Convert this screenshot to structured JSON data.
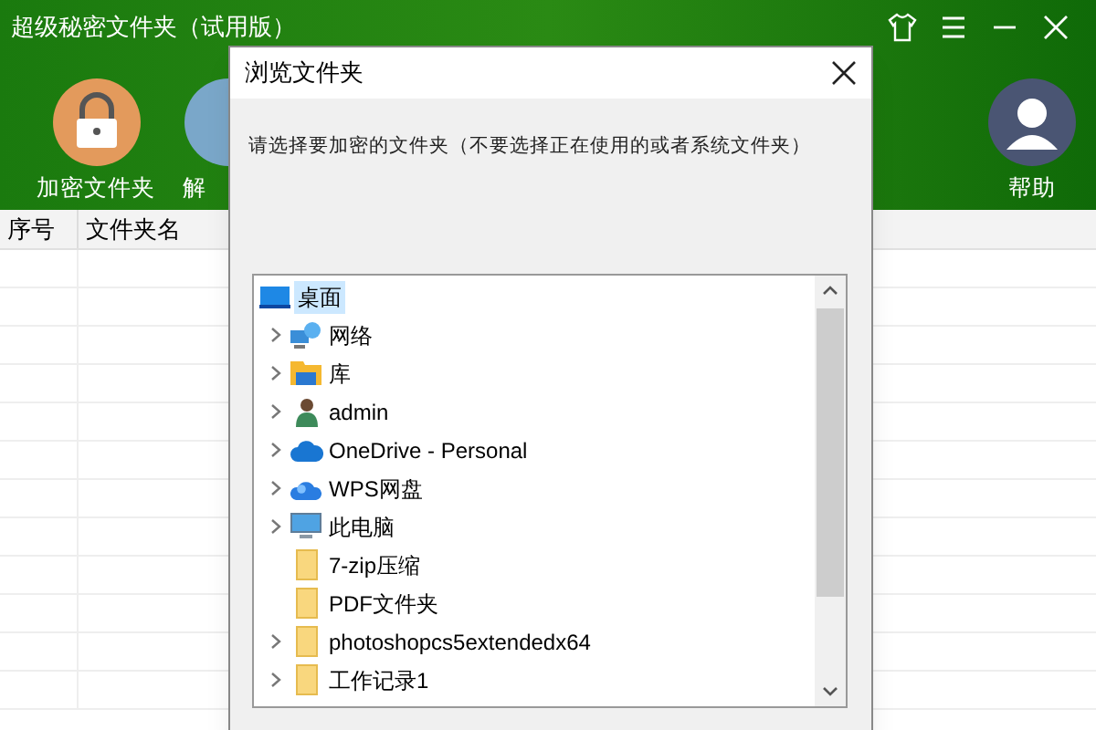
{
  "window": {
    "title": "超级秘密文件夹（试用版）"
  },
  "toolbar": [
    {
      "label": "加密文件夹",
      "kind": "lock"
    },
    {
      "label": "解",
      "kind": "unlock"
    },
    {
      "label": "帮助",
      "kind": "help"
    }
  ],
  "table": {
    "columns": [
      "序号",
      "文件夹名"
    ]
  },
  "dialog": {
    "title": "浏览文件夹",
    "instruction": "请选择要加密的文件夹（不要选择正在使用的或者系统文件夹）",
    "tree": [
      {
        "label": "桌面",
        "kind": "desktop",
        "selected": true,
        "children": [
          {
            "label": "网络",
            "kind": "network",
            "selected": false,
            "expandable": true
          },
          {
            "label": "库",
            "kind": "library",
            "selected": false,
            "expandable": true
          },
          {
            "label": "admin",
            "kind": "user",
            "selected": false,
            "expandable": true
          },
          {
            "label": "OneDrive - Personal",
            "kind": "cloud",
            "selected": false,
            "expandable": true
          },
          {
            "label": "WPS网盘",
            "kind": "wps",
            "selected": false,
            "expandable": true
          },
          {
            "label": "此电脑",
            "kind": "computer",
            "selected": false,
            "expandable": true
          },
          {
            "label": "7-zip压缩",
            "kind": "folder",
            "selected": false,
            "expandable": false
          },
          {
            "label": "PDF文件夹",
            "kind": "folder",
            "selected": false,
            "expandable": false
          },
          {
            "label": "photoshopcs5extendedx64",
            "kind": "folder",
            "selected": false,
            "expandable": true
          },
          {
            "label": "工作记录1",
            "kind": "folder",
            "selected": false,
            "expandable": true
          }
        ]
      }
    ]
  }
}
